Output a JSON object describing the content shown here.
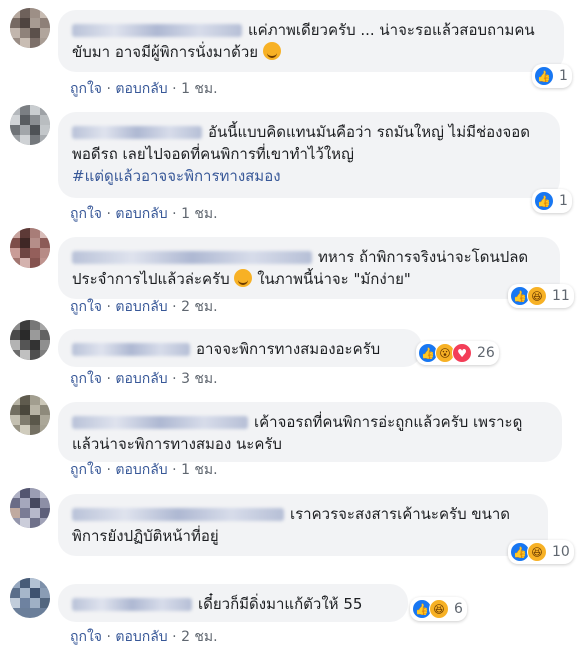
{
  "comments": [
    {
      "text": "แค่ภาพเดียวครับ ... น่าจะรอแล้วสอบถามคนขับมา อาจมีผู้พิการนั่งมาด้วย",
      "emoji": "crying-face",
      "actions": {
        "like": "ถูกใจ",
        "reply": "ตอบกลับ",
        "time": "1 ชม."
      },
      "reactions": [
        "like"
      ],
      "count": "1"
    },
    {
      "text": "อันนี้แบบคิดแทนมันคือว่า รถมันใหญ่ ไม่มีช่องจอดพอดีรถ เลยไปจอดที่คนพิการที่เขาทำไว้ใหญ่",
      "hashtag": "#แต่ดูแล้วอาจจะพิการทางสมอง",
      "actions": {
        "like": "ถูกใจ",
        "reply": "ตอบกลับ",
        "time": "1 ชม."
      },
      "reactions": [
        "like"
      ],
      "count": "1"
    },
    {
      "text": "ทหาร ถ้าพิการจริงน่าจะโดนปลดประจำการไปแล้วล่ะครับ",
      "text2": "ในภาพนี้น่าจะ \"มักง่าย\"",
      "emoji": "relieved-face",
      "actions": {
        "like": "ถูกใจ",
        "reply": "ตอบกลับ",
        "time": "2 ชม."
      },
      "reactions": [
        "like",
        "haha"
      ],
      "count": "11"
    },
    {
      "text": "อาจจะพิการทางสมองอะครับ",
      "actions": {
        "like": "ถูกใจ",
        "reply": "ตอบกลับ",
        "time": "3 ชม."
      },
      "reactions": [
        "like",
        "wow",
        "love"
      ],
      "count": "26"
    },
    {
      "text": "เค้าจอรถที่คนพิการอ่ะถูกแล้วครับ เพราะดูแล้วน่าจะพิการทางสมอง นะครับ",
      "actions": {
        "like": "ถูกใจ",
        "reply": "ตอบกลับ",
        "time": "1 ชม."
      }
    },
    {
      "text": "เราควรจะสงสารเค้านะครับ ขนาดพิการยังปฏิบัติหน้าที่อยู่",
      "actions": {
        "like": "ถูกใจ",
        "reply": "ตอบกลับ",
        "time": ""
      },
      "reactions": [
        "like",
        "haha"
      ],
      "count": "10"
    },
    {
      "text": "เดี๋ยวก็มีดิ่งมาแก้ตัวให้ 55",
      "actions": {
        "like": "ถูกใจ",
        "reply": "ตอบกลับ",
        "time": "2 ชม."
      },
      "reactions": [
        "like",
        "haha"
      ],
      "count": "6"
    }
  ],
  "separator": "·",
  "icons": {
    "like": "thumbs-up-icon",
    "haha": "laughing-face-icon",
    "wow": "surprised-face-icon",
    "love": "heart-icon"
  },
  "colors": {
    "link": "#385898",
    "bubble": "#f2f3f5",
    "like": "#1877f2"
  }
}
